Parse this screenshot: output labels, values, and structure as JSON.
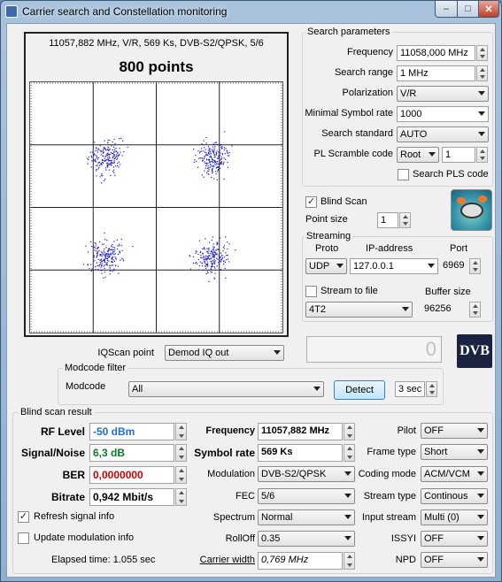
{
  "window": {
    "title": "Carrier search and Constellation monitoring",
    "min": "–",
    "max": "□",
    "close": "✕"
  },
  "plot": {
    "info": "11057,882 MHz, V/R, 569 Ks, DVB-S2/QPSK, 5/6",
    "points_label": "800 points"
  },
  "search_params": {
    "title": "Search parameters",
    "frequency_label": "Frequency",
    "frequency_value": "11058,000 MHz",
    "range_label": "Search range",
    "range_value": "1 MHz",
    "polarization_label": "Polarization",
    "polarization_value": "V/R",
    "min_sr_label": "Minimal Symbol rate",
    "min_sr_value": "1000",
    "standard_label": "Search standard",
    "standard_value": "AUTO",
    "pls_label": "PL Scramble code",
    "pls_mode": "Root",
    "pls_value": "1",
    "search_pls_label": "Search PLS code"
  },
  "blind": {
    "label": "Blind Scan",
    "checked": "✓",
    "point_size_label": "Point size",
    "point_size_value": "1"
  },
  "streaming": {
    "title": "Streaming",
    "proto_label": "Proto",
    "ip_label": "IP-address",
    "port_label": "Port",
    "proto_value": "UDP",
    "ip_value": "127.0.0.1",
    "port_value": "6969",
    "stream_file_label": "Stream to file",
    "buffer_label": "Buffer size",
    "file_value": "4T2",
    "buffer_value": "96256"
  },
  "iq": {
    "label": "IQScan point",
    "value": "Demod IQ out",
    "counter": "0"
  },
  "modcode": {
    "title": "Modcode filter",
    "label": "Modcode",
    "value": "All",
    "detect": "Detect",
    "interval": "3 sec"
  },
  "result": {
    "title": "Blind scan result",
    "rf_label": "RF Level",
    "rf_value": "-50 dBm",
    "sn_label": "Signal/Noise",
    "sn_value": "6,3 dB",
    "ber_label": "BER",
    "ber_value": "0,0000000",
    "bitrate_label": "Bitrate",
    "bitrate_value": "0,942 Mbit/s",
    "refresh_label": "Refresh signal info",
    "refresh_checked": "✓",
    "update_label": "Update modulation info",
    "elapsed": "Elapsed time: 1.055 sec",
    "freq_label": "Frequency",
    "freq_value": "11057,882 MHz",
    "sr_label": "Symbol rate",
    "sr_value": "569 Ks",
    "mod_label": "Modulation",
    "mod_value": "DVB-S2/QPSK",
    "fec_label": "FEC",
    "fec_value": "5/6",
    "spectrum_label": "Spectrum",
    "spectrum_value": "Normal",
    "rolloff_label": "RollOff",
    "rolloff_value": "0.35",
    "cw_label": "Carrier width",
    "cw_value": "0,769 MHz",
    "pilot_label": "Pilot",
    "pilot_value": "OFF",
    "frame_label": "Frame type",
    "frame_value": "Short",
    "coding_label": "Coding mode",
    "coding_value": "ACM/VCM",
    "stype_label": "Stream type",
    "stype_value": "Continous",
    "istream_label": "Input stream",
    "istream_value": "Multi (0)",
    "issyi_label": "ISSYI",
    "issyi_value": "OFF",
    "npd_label": "NPD",
    "npd_value": "OFF"
  },
  "colors": {
    "point": "#1a1acc",
    "rf": "#1e6fd0",
    "sn": "#0a7a2a",
    "ber": "#d00000"
  }
}
